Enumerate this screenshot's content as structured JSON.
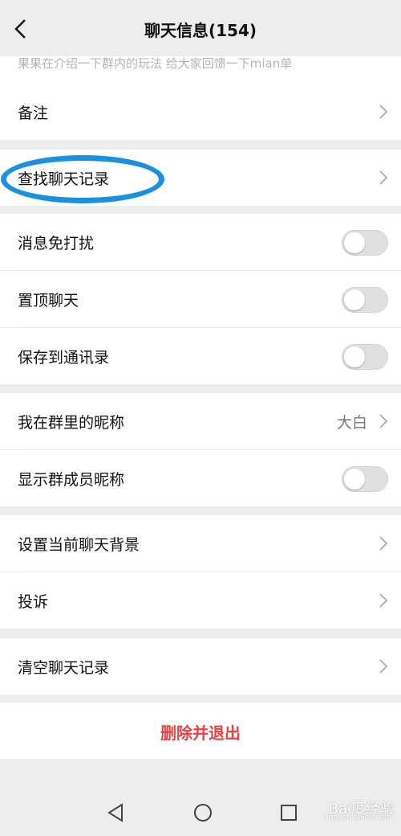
{
  "header": {
    "title": "聊天信息(154)"
  },
  "notice": "果果在介绍一下群内的玩法 给大家回馈一下mian单",
  "rows": {
    "remark": "备注",
    "search_history": "查找聊天记录",
    "mute": "消息免打扰",
    "pin": "置顶聊天",
    "save_contacts": "保存到通讯录",
    "my_nickname": "我在群里的昵称",
    "my_nickname_value": "大白",
    "show_nicknames": "显示群成员昵称",
    "background": "设置当前聊天背景",
    "complain": "投诉",
    "clear_history": "清空聊天记录"
  },
  "toggles": {
    "mute": false,
    "pin": false,
    "save_contacts": false,
    "show_nicknames": false
  },
  "delete_exit": "删除并退出",
  "watermark": {
    "brand": "Bai度经验",
    "url": "jingyan.baidu.com"
  },
  "colors": {
    "danger": "#e64340",
    "highlight": "#1b8fe0",
    "background": "#ededed"
  },
  "icons": [
    "back-arrow-icon",
    "chevron-right-icon",
    "nav-back-icon",
    "nav-home-icon",
    "nav-recents-icon"
  ]
}
